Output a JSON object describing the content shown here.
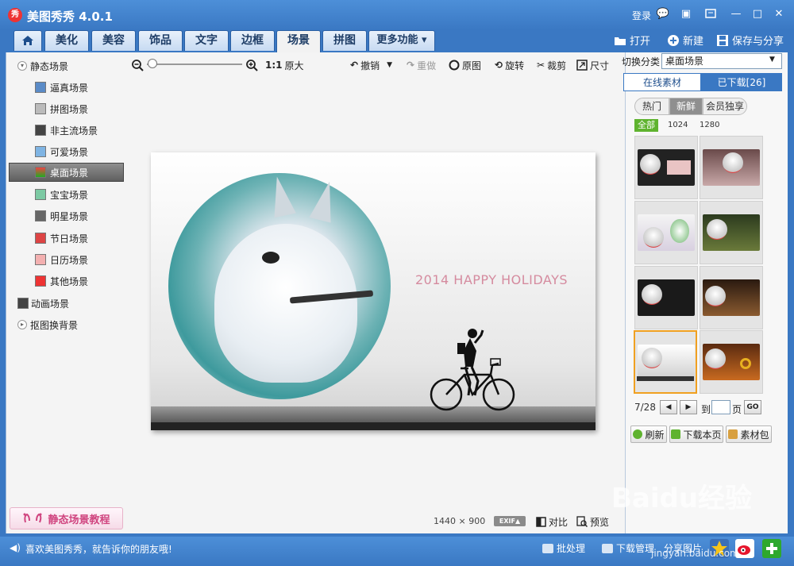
{
  "window": {
    "title": "美图秀秀 4.0.1",
    "logo_text": "秀",
    "login": "登录",
    "controls": [
      "💬",
      "▣",
      "—",
      "□",
      "✕"
    ]
  },
  "tabs": [
    {
      "label": "美化"
    },
    {
      "label": "美容"
    },
    {
      "label": "饰品"
    },
    {
      "label": "文字"
    },
    {
      "label": "边框"
    },
    {
      "label": "场景"
    },
    {
      "label": "拼图"
    },
    {
      "label": "更多功能 ▾"
    }
  ],
  "top_actions": {
    "open": "打开",
    "new": "新建",
    "save_share": "保存与分享"
  },
  "left_nav": {
    "static_group": "静态场景",
    "items": [
      {
        "label": "逼真场景"
      },
      {
        "label": "拼图场景"
      },
      {
        "label": "非主流场景"
      },
      {
        "label": "可爱场景"
      },
      {
        "label": "桌面场景"
      },
      {
        "label": "宝宝场景"
      },
      {
        "label": "明星场景"
      },
      {
        "label": "节日场景"
      },
      {
        "label": "日历场景"
      },
      {
        "label": "其他场景"
      }
    ],
    "animated_group": "动画场景",
    "cutout_group": "抠图换背景",
    "tutorial_button": "静态场景教程"
  },
  "toolbar": {
    "ratio": "1:1",
    "original_size": "原大",
    "undo": "撤销",
    "redo": "重做",
    "original": "原图",
    "rotate": "旋转",
    "crop": "裁剪",
    "size": "尺寸"
  },
  "canvas": {
    "holiday_text": "2014 HAPPY HOLIDAYS",
    "image_size": "1440 × 900",
    "exif": "EXIF▲",
    "compare": "对比",
    "preview": "预览"
  },
  "right_panel": {
    "switch_label": "切换分类",
    "category_value": "桌面场景",
    "tab_online": "在线素材",
    "tab_downloaded": "已下载[26]",
    "seg_hot": "热门",
    "seg_new": "新鲜",
    "seg_vip": "会员独享",
    "filter_all": "全部",
    "filter_1024": "1024",
    "filter_1280": "1280",
    "page_info": "7/28",
    "goto": "到",
    "page_unit": "页",
    "go": "GO",
    "refresh": "刷新",
    "download_page": "下载本页",
    "material_pack": "素材包"
  },
  "status_bar": {
    "message": "喜欢美图秀秀，就告诉你的朋友哦!",
    "batch": "批处理",
    "download_manager": "下载管理",
    "share_picture": "分享图片"
  },
  "watermark": {
    "main": "Baidu经验",
    "sub": "jingyan.baidu.com"
  }
}
